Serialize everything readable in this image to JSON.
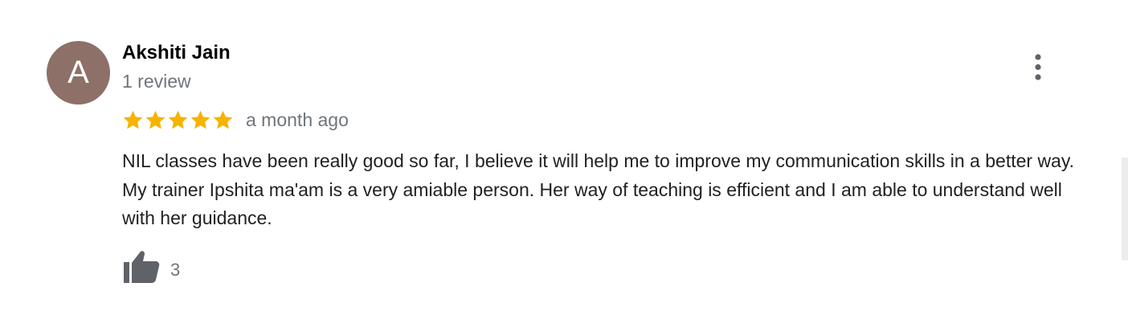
{
  "review": {
    "avatar_letter": "A",
    "avatar_color": "#8d7068",
    "author_name": "Akshiti Jain",
    "review_count": "1 review",
    "rating": 5,
    "rating_max": 5,
    "star_color": "#f4b400",
    "time_ago": "a month ago",
    "text": "NIL classes have been really good so far, I believe it will help me to improve my communication skills in a better way. My trainer Ipshita ma'am is a very amiable person. Her way of teaching is efficient and I am able to understand well with her guidance.",
    "like_count": "3",
    "icons": {
      "more": "more-vert-icon",
      "like": "thumb-up-icon",
      "star": "star-icon"
    }
  }
}
